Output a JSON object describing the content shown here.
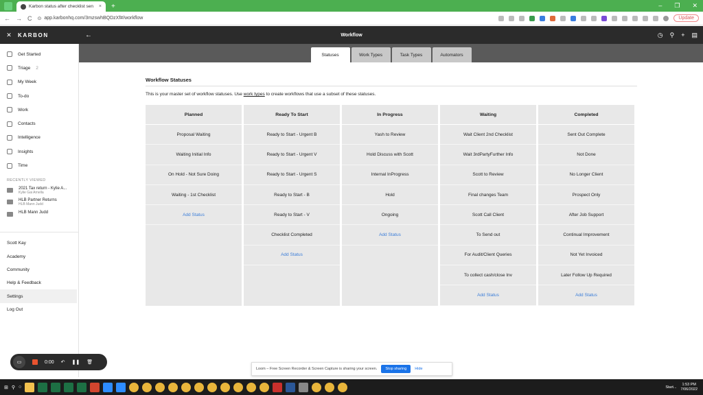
{
  "browser": {
    "tab_title": "Karbon status after checklist sen",
    "tab_close": "×",
    "new_tab": "+",
    "url": "app.karbonhq.com/3mzswhBQDzXf#/workflow",
    "update_label": "Update",
    "back": "←",
    "forward": "→",
    "reload": "C",
    "lock": "⊙",
    "win_min": "–",
    "win_max": "❐",
    "win_close": "✕"
  },
  "app_header": {
    "close": "✕",
    "brand": "KARBON",
    "back": "←",
    "title": "Workflow",
    "icons": [
      "timer-icon",
      "search-icon",
      "plus-icon",
      "notes-icon"
    ],
    "icon_glyphs": [
      "◷",
      "⚲",
      "+",
      "▤"
    ]
  },
  "sidebar": {
    "items": [
      {
        "label": "Get Started",
        "icon": "home-icon"
      },
      {
        "label": "Triage",
        "count": "2",
        "icon": "triage-icon"
      },
      {
        "label": "My Week",
        "icon": "week-icon"
      },
      {
        "label": "To-do",
        "icon": "todo-icon"
      },
      {
        "label": "Work",
        "icon": "work-icon"
      },
      {
        "label": "Contacts",
        "icon": "contacts-icon"
      },
      {
        "label": "Intelligence",
        "icon": "intelligence-icon"
      },
      {
        "label": "Insights",
        "icon": "insights-icon"
      },
      {
        "label": "Time",
        "icon": "time-icon"
      }
    ],
    "recently_viewed_title": "RECENTLY VIEWED",
    "recent": [
      {
        "title": "2021 Tax return - Kylie A...",
        "sub": "Kylie Gai Arnella"
      },
      {
        "title": "HLB Partner Returns",
        "sub": "HLB Mann Judd"
      },
      {
        "title": "HLB Mann Judd",
        "sub": ""
      }
    ],
    "bottom": [
      "Scott Kay",
      "Academy",
      "Community",
      "Help & Feedback",
      "Settings",
      "Log Out"
    ],
    "active_bottom": "Settings"
  },
  "tabs": [
    "Statuses",
    "Work Types",
    "Task Types",
    "Automators"
  ],
  "active_tab": "Statuses",
  "section": {
    "title": "Workflow Statuses",
    "intro_before": "This is your master set of workflow statuses. Use ",
    "intro_link": "work types",
    "intro_after": " to create workflows that use a subset of these statuses."
  },
  "columns": [
    {
      "name": "Planned",
      "items": [
        "Proposal Waiting",
        "Waiting Initial Info",
        "On Hold - Not Sure Doing",
        "Waiting - 1st Checklist"
      ]
    },
    {
      "name": "Ready To Start",
      "items": [
        "Ready to Start - Urgent B",
        "Ready to Start - Urgent V",
        "Ready to Start - Urgent S",
        "Ready to Start - B",
        "Ready to Start - V",
        "Checklist Completed"
      ]
    },
    {
      "name": "In Progress",
      "items": [
        "Yash to Review",
        "Hold Discuss with Scott",
        "Internal InProgress",
        "Hold",
        "Ongoing"
      ]
    },
    {
      "name": "Waiting",
      "items": [
        "Wait Client 2nd Checklist",
        "Wait 3rdPartyFurther Info",
        "Scott to Review",
        "Final changes Team",
        "Scott Call Client",
        "To Send out",
        "For Audit/Client Queries",
        "To collect cash/close Inv"
      ]
    },
    {
      "name": "Completed",
      "items": [
        "Sent Out Complete",
        "Not Done",
        "No Longer Client",
        "Prospect Only",
        "After Job Support",
        "Continual Improvement",
        "Not Yet Invoiced",
        "Later Follow Up Required"
      ]
    }
  ],
  "add_status_label": "Add Status",
  "recorder": {
    "time": "0:00",
    "cam": "▭",
    "undo": "↶",
    "pause": "❚❚",
    "trash": "🗑"
  },
  "sharebar": {
    "text": "Loom – Free Screen Recorder & Screen Capture is sharing your screen.",
    "stop": "Stop sharing",
    "hide": "Hide"
  },
  "taskbar": {
    "start": "⊞",
    "search": "⚲",
    "cortana": "○",
    "weather": "Start...",
    "time": "1:53 PM",
    "date": "7/06/2022"
  },
  "colors": {
    "browser_green": "#16a75c",
    "header": "#2b2b2b",
    "tabs_bar": "#5a5a5a",
    "column_bg": "#e8e8e8",
    "link_blue": "#3b7dd8"
  }
}
